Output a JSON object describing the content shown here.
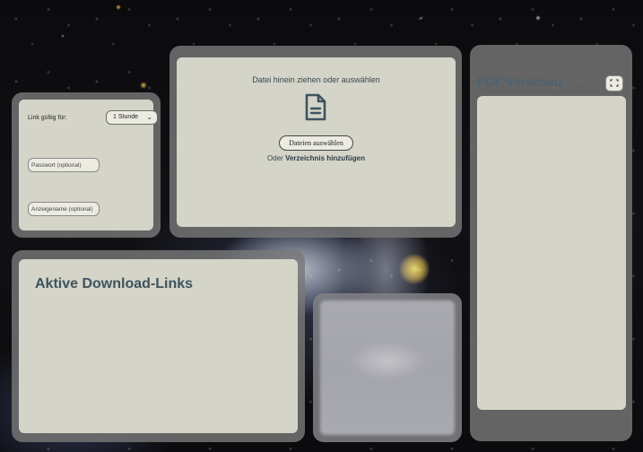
{
  "settings": {
    "validity_label": "Link gültig für:",
    "validity_selected": "1 Stunde",
    "password_placeholder": "Passwort (optional)",
    "displayname_placeholder": "Anzeigename (optional)"
  },
  "upload": {
    "drop_text": "Datei hinein ziehen oder auswählen",
    "choose_button": "Dateien auswählen",
    "or_text": "Oder",
    "add_folder_link": "Verzeichnis hinzufügen",
    "file_icon": "file-text-icon"
  },
  "links": {
    "title": "Aktive Download-Links"
  },
  "pdf": {
    "title": "PDF Vorschau",
    "fullscreen_icon": "expand-icon"
  }
}
